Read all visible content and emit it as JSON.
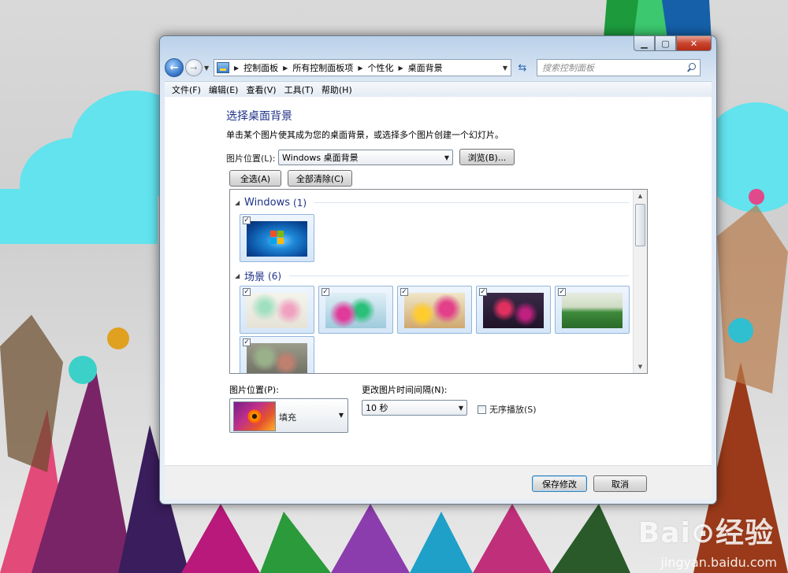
{
  "window": {
    "caption": {
      "minimize": "▁",
      "maximize": "▢",
      "close": "✕"
    }
  },
  "nav": {
    "breadcrumbs": [
      "控制面板",
      "所有控制面板项",
      "个性化",
      "桌面背景"
    ],
    "search_placeholder": "搜索控制面板"
  },
  "menu": [
    "文件(F)",
    "编辑(E)",
    "查看(V)",
    "工具(T)",
    "帮助(H)"
  ],
  "page": {
    "title": "选择桌面背景",
    "description": "单击某个图片使其成为您的桌面背景，或选择多个图片创建一个幻灯片。",
    "location_label": "图片位置(L):",
    "location_value": "Windows 桌面背景",
    "browse_button": "浏览(B)...",
    "select_all_button": "全选(A)",
    "clear_all_button": "全部清除(C)"
  },
  "gallery": {
    "groups": [
      {
        "name": "Windows",
        "count": "(1)",
        "items": 1
      },
      {
        "name": "场景",
        "count": "(6)",
        "items": 6
      }
    ],
    "check_mark": "✓"
  },
  "options": {
    "position_label": "图片位置(P):",
    "position_value": "填充",
    "interval_label": "更改图片时间间隔(N):",
    "interval_value": "10 秒",
    "shuffle_label": "无序播放(S)",
    "shuffle_checked": false
  },
  "footer": {
    "save_button": "保存修改",
    "cancel_button": "取消"
  },
  "watermark": {
    "brand": "Bai⊙经验",
    "site": "jingyan.baidu.com"
  }
}
